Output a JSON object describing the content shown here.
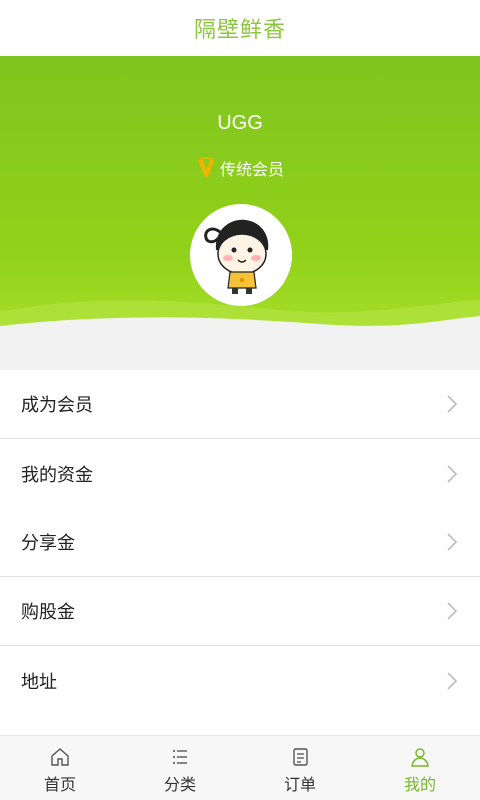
{
  "header": {
    "title": "隔壁鲜香"
  },
  "profile": {
    "username": "UGG",
    "member_label": "传统会员",
    "member_icon": "v-badge-icon",
    "avatar_icon": "cartoon-avatar-icon"
  },
  "menu": {
    "items": [
      {
        "label": "成为会员",
        "icon": "chevron-right-icon"
      },
      {
        "label": "我的资金",
        "icon": "chevron-right-icon"
      },
      {
        "label": "分享金",
        "icon": "chevron-right-icon"
      },
      {
        "label": "购股金",
        "icon": "chevron-right-icon"
      },
      {
        "label": "地址",
        "icon": "chevron-right-icon"
      }
    ]
  },
  "tabbar": {
    "tabs": [
      {
        "label": "首页",
        "icon": "home-icon"
      },
      {
        "label": "分类",
        "icon": "list-icon"
      },
      {
        "label": "订单",
        "icon": "order-icon"
      },
      {
        "label": "我的",
        "icon": "user-icon",
        "active": true
      }
    ]
  },
  "colors": {
    "brand": "#8cc63f",
    "hero": "#8fcf1c",
    "active_tab": "#78b82a"
  }
}
